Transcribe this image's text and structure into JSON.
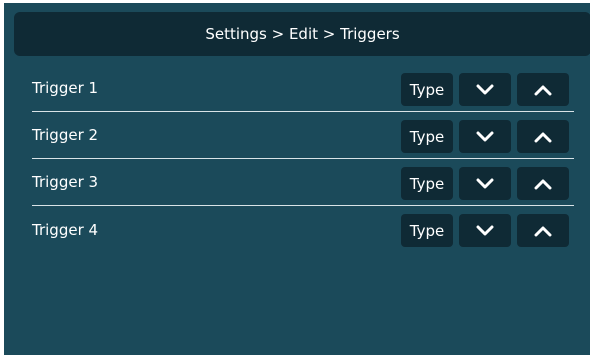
{
  "header": {
    "breadcrumb": "Settings > Edit > Triggers"
  },
  "triggers": [
    {
      "label": "Trigger 1",
      "type_label": "Type"
    },
    {
      "label": "Trigger 2",
      "type_label": "Type"
    },
    {
      "label": "Trigger 3",
      "type_label": "Type"
    },
    {
      "label": "Trigger 4",
      "type_label": "Type"
    }
  ],
  "icons": {
    "down": "chevron-down-icon",
    "up": "chevron-up-icon"
  },
  "colors": {
    "background": "#1b4a5a",
    "header_bg": "#0f2a35",
    "button_bg": "#0f2a35",
    "divider": "#d9e3e7",
    "text": "#ffffff"
  }
}
